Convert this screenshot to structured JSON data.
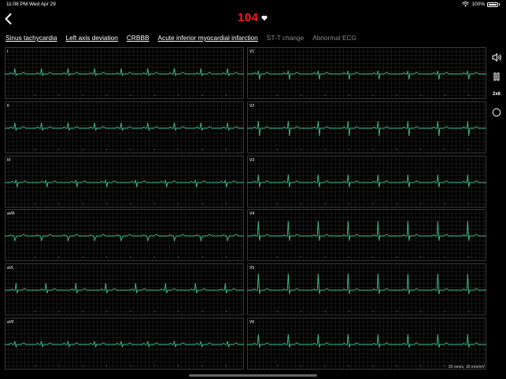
{
  "status_bar": {
    "time": "11:08 PM",
    "date": "Wed Apr 29",
    "battery": "100%"
  },
  "heart_rate": "104",
  "diagnoses": [
    {
      "label": "Sinus tachycardia",
      "underlined": true
    },
    {
      "label": "Left axis deviation",
      "underlined": true
    },
    {
      "label": "CRBBB",
      "underlined": true
    },
    {
      "label": "Acute inferior myocardial infarction",
      "underlined": true
    },
    {
      "label": "ST-T change",
      "underlined": false
    },
    {
      "label": "Abnormal ECG",
      "underlined": false
    }
  ],
  "leads": [
    "I",
    "II",
    "III",
    "aVR",
    "aVL",
    "aVF",
    "V1",
    "V2",
    "V3",
    "V4",
    "V5",
    "V6"
  ],
  "scale_label": "25 mm/s, 10 mm/mV",
  "layout_button": "2x6",
  "icons": {
    "back": "chevron-left-icon",
    "heart": "heart-icon",
    "sound": "speaker-icon",
    "pause": "pause-icon",
    "record": "circle-icon"
  },
  "colors": {
    "heart_rate": "#ff1a1a",
    "trace": "#3fbf8c",
    "grid": "#2b2b2b",
    "background": "#000000"
  }
}
